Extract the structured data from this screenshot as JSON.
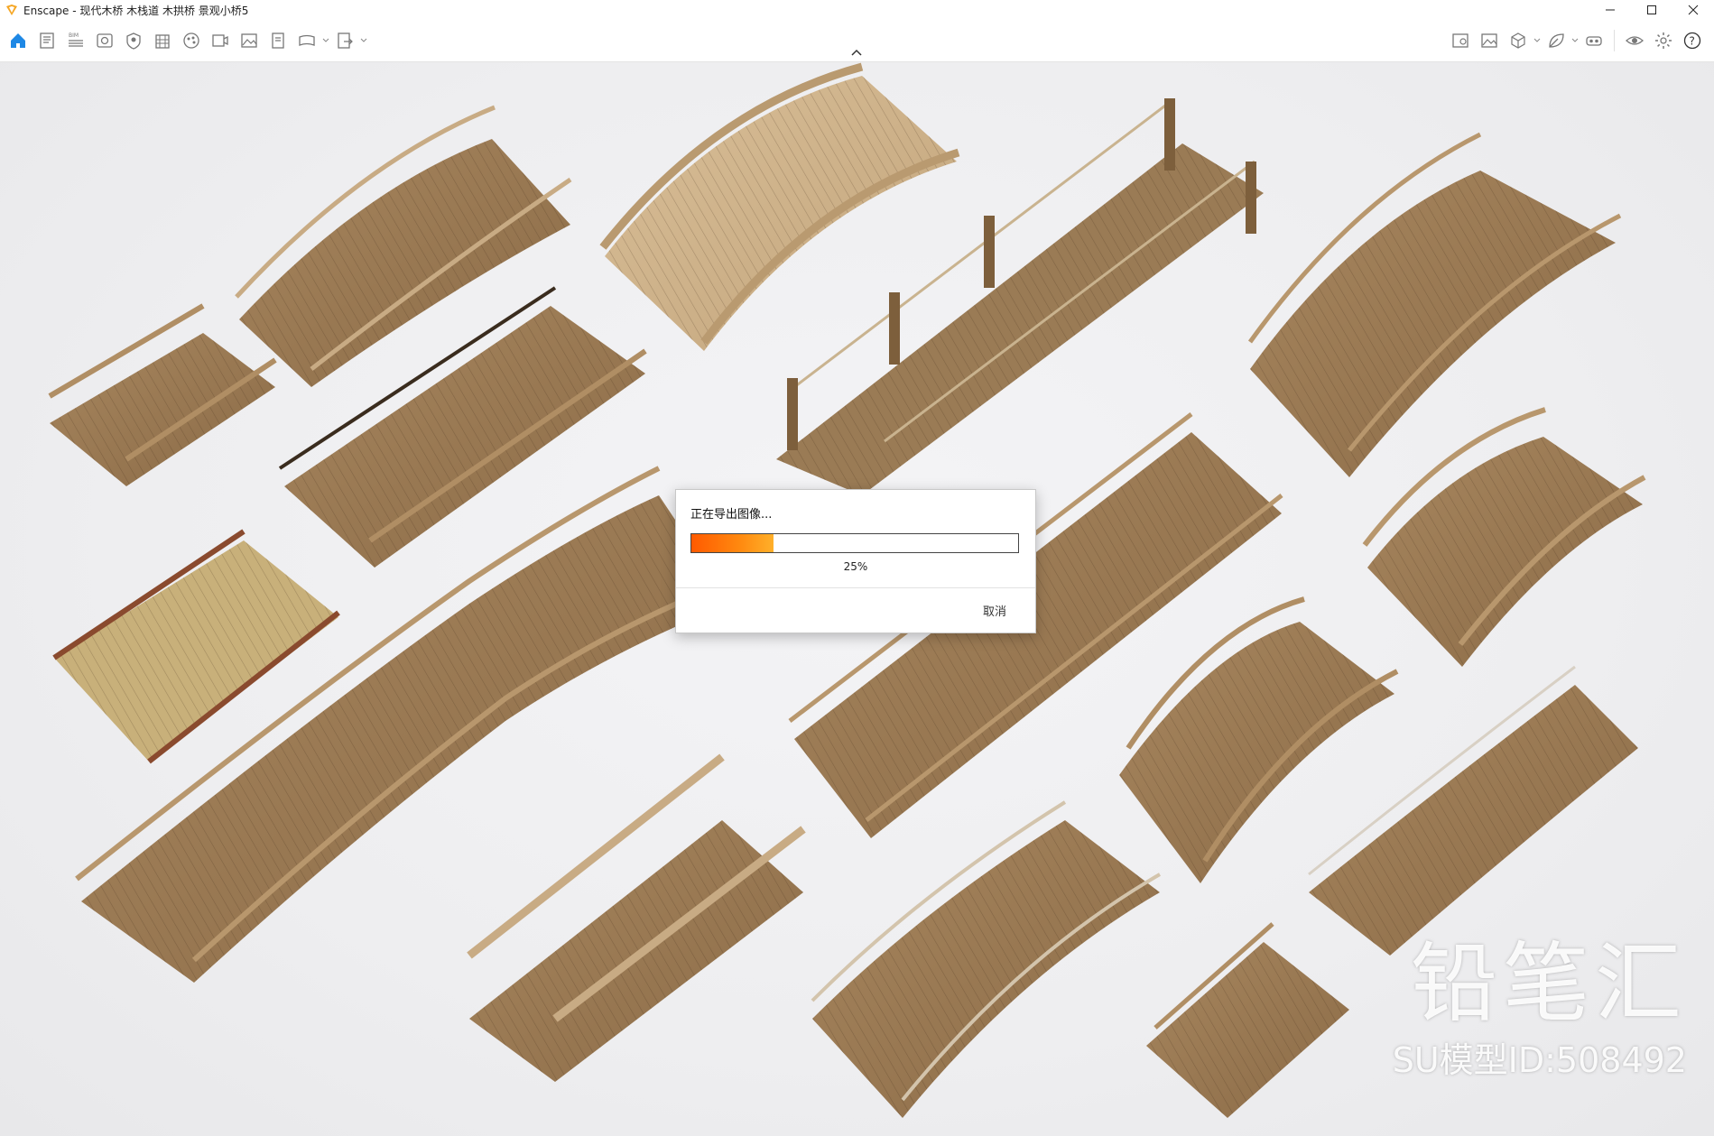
{
  "window": {
    "title": "Enscape - 现代木桥 木栈道 木拱桥 景观小桥5"
  },
  "toolbar": {
    "left_tools": [
      {
        "icon": "home-icon",
        "label": ""
      },
      {
        "icon": "project-icon",
        "label": ""
      },
      {
        "icon": "bim-icon",
        "label": "BIM"
      },
      {
        "icon": "visual-settings-icon",
        "label": ""
      },
      {
        "icon": "asset-library-icon",
        "label": ""
      },
      {
        "icon": "building-icon",
        "label": ""
      },
      {
        "icon": "material-editor-icon",
        "label": ""
      },
      {
        "icon": "views-icon",
        "label": ""
      },
      {
        "icon": "screenshot-icon",
        "label": ""
      },
      {
        "icon": "batch-render-icon",
        "label": ""
      },
      {
        "icon": "panorama-icon",
        "label": ""
      },
      {
        "icon": "export-icon",
        "label": ""
      }
    ],
    "right_tools": [
      {
        "icon": "map-icon"
      },
      {
        "icon": "image-icon"
      },
      {
        "icon": "cube-icon"
      },
      {
        "icon": "leaf-icon"
      },
      {
        "icon": "vr-headset-icon"
      },
      {
        "icon": "eye-icon"
      },
      {
        "icon": "settings-icon"
      },
      {
        "icon": "help-icon"
      }
    ]
  },
  "viewport": {
    "watermark_brand": "铅笔汇",
    "watermark_id": "SU模型ID:508492"
  },
  "dialog": {
    "title": "正在导出图像...",
    "progress": 0.25,
    "progress_label": "25%",
    "cancel_label": "取消"
  },
  "colors": {
    "accent": "#1e88e5",
    "progress": "#ff6a00",
    "wood": "#9b7a55"
  }
}
